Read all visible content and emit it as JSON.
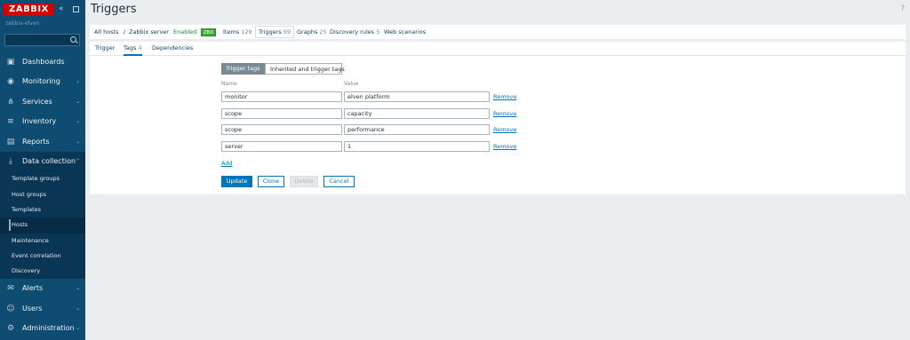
{
  "sidebar": {
    "logo": "ZABBIX",
    "server_name": "zabbix-elven",
    "search_placeholder": "",
    "items": [
      {
        "label": "Dashboards",
        "icon": "dashboard-icon",
        "glyph": "▣"
      },
      {
        "label": "Monitoring",
        "icon": "eye-icon",
        "glyph": "◉"
      },
      {
        "label": "Services",
        "icon": "services-icon",
        "glyph": "⋔"
      },
      {
        "label": "Inventory",
        "icon": "list-icon",
        "glyph": "≡"
      },
      {
        "label": "Reports",
        "icon": "report-icon",
        "glyph": "▤"
      },
      {
        "label": "Data collection",
        "icon": "download-icon",
        "glyph": "⤓"
      }
    ],
    "data_collection_sub": [
      {
        "label": "Template groups"
      },
      {
        "label": "Host groups"
      },
      {
        "label": "Templates"
      },
      {
        "label": "Hosts"
      },
      {
        "label": "Maintenance"
      },
      {
        "label": "Event correlation"
      },
      {
        "label": "Discovery"
      }
    ],
    "bottom_items": [
      {
        "label": "Alerts",
        "icon": "mail-icon",
        "glyph": "✉"
      },
      {
        "label": "Users",
        "icon": "users-icon",
        "glyph": "☺"
      },
      {
        "label": "Administration",
        "icon": "gear-icon",
        "glyph": "⚙"
      }
    ]
  },
  "header": {
    "title": "Triggers",
    "help": "?"
  },
  "breadcrumbs": {
    "all_hosts": "All hosts",
    "sep": "/",
    "host": "Zabbix server",
    "status": "Enabled",
    "badge": "ZBX",
    "items_label": "Items",
    "items_count": "129",
    "triggers_label": "Triggers",
    "triggers_count": "69",
    "graphs_label": "Graphs",
    "graphs_count": "25",
    "discovery_label": "Discovery rules",
    "discovery_count": "5",
    "web_label": "Web scenarios"
  },
  "tabs": {
    "trigger": "Trigger",
    "tags": "Tags",
    "tags_count": "4",
    "dependencies": "Dependencies"
  },
  "subtabs": {
    "trigger_tags": "Trigger tags",
    "inherited": "Inherited and trigger tags"
  },
  "tags_table": {
    "name_header": "Name",
    "value_header": "Value",
    "remove_label": "Remove",
    "rows": [
      {
        "name": "monitor",
        "value": "elven platform"
      },
      {
        "name": "scope",
        "value": "capacity"
      },
      {
        "name": "scope",
        "value": "performance"
      },
      {
        "name": "server",
        "value": "1"
      }
    ],
    "add_label": "Add"
  },
  "buttons": {
    "update": "Update",
    "clone": "Clone",
    "delete": "Delete",
    "cancel": "Cancel"
  },
  "colors": {
    "sidebar_bg": "#0e4c71",
    "logo_bg": "#d40000",
    "accent": "#0275b8",
    "enabled_green": "#0d8f2e"
  }
}
